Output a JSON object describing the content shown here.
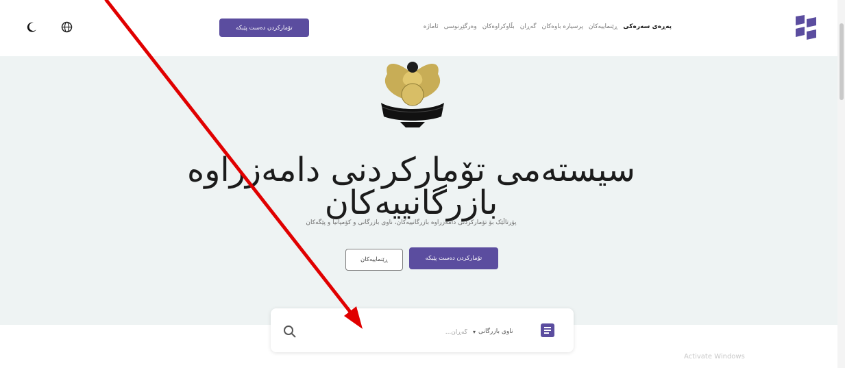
{
  "header": {
    "logo_icon": "brand-logo-icon",
    "nav_items": [
      "پەڕەی سەرەکی",
      "ڕێنماییەکان",
      "پرسیارە باوەکان",
      "گەڕان",
      "بڵاوکراوەکان",
      "وەرگێڕنوسی",
      "ئاماژە"
    ],
    "register_button": "تۆمارکردن دەست پێبکە",
    "theme_toggle_icon": "moon-icon",
    "language_icon": "globe-icon"
  },
  "hero": {
    "emblem_icon": "kurdistan-emblem-icon",
    "title": "سیستەمی تۆمارکردنی دامەزراوە بازرگانییەکان",
    "subtitle": "پۆرتاڵێک بۆ تۆمارکردنی دامەزراوە بازرگانییەکان، ناوی بازرگانی و کۆمپانیا و پێگەکان",
    "primary_button": "تۆمارکردن دەست پێبکە",
    "secondary_button": "ڕێنماییەکان"
  },
  "search": {
    "field_label": "ناوی بازرگانی",
    "placeholder": "گەڕان...",
    "search_icon": "search-icon",
    "doc_icon": "document-icon"
  },
  "watermark": "Activate Windows",
  "colors": {
    "accent": "#5b4d9f",
    "hero_bg": "#eef3f3",
    "annotation_arrow": "#e00000"
  }
}
